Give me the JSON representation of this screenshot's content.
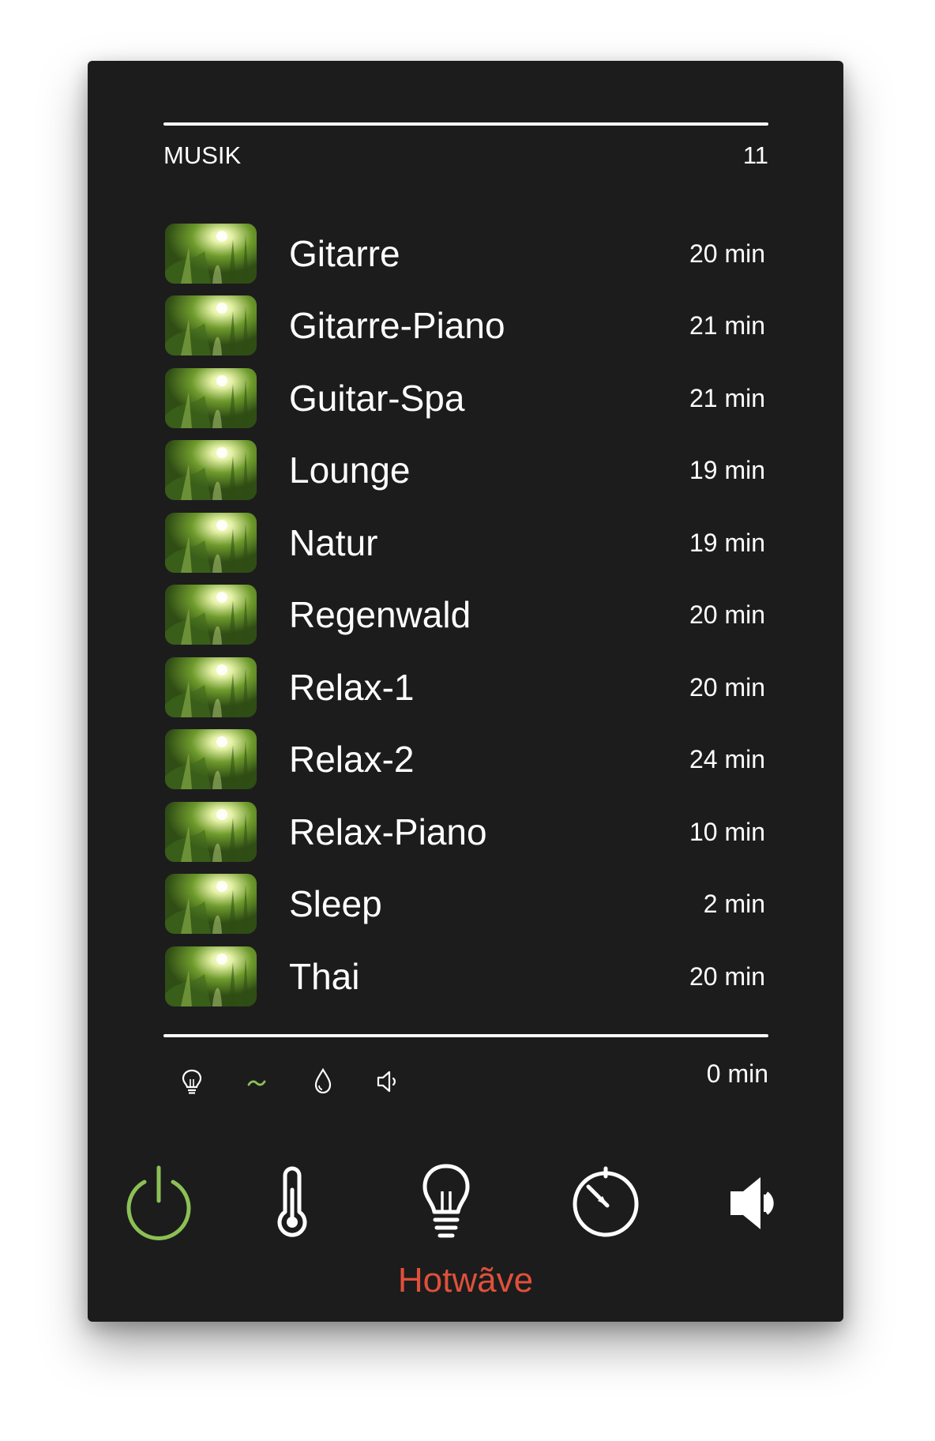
{
  "header": {
    "title": "MUSIK",
    "count": "11"
  },
  "tracks": [
    {
      "name": "Gitarre",
      "duration": "20 min"
    },
    {
      "name": "Gitarre-Piano",
      "duration": "21 min"
    },
    {
      "name": "Guitar-Spa",
      "duration": "21 min"
    },
    {
      "name": "Lounge",
      "duration": "19 min"
    },
    {
      "name": "Natur",
      "duration": "19 min"
    },
    {
      "name": "Regenwald",
      "duration": "20 min"
    },
    {
      "name": "Relax-1",
      "duration": "20 min"
    },
    {
      "name": "Relax-2",
      "duration": "24 min"
    },
    {
      "name": "Relax-Piano",
      "duration": "10 min"
    },
    {
      "name": "Sleep",
      "duration": "2 min"
    },
    {
      "name": "Thai",
      "duration": "20 min"
    }
  ],
  "status": {
    "icons": [
      "light-bulb-icon",
      "wave-icon",
      "water-drop-icon",
      "speaker-icon"
    ],
    "elapsed": "0 min"
  },
  "controls": [
    {
      "name": "power-icon",
      "active": true
    },
    {
      "name": "thermometer-icon",
      "active": false
    },
    {
      "name": "light-bulb-icon",
      "active": false
    },
    {
      "name": "timer-icon",
      "active": false
    },
    {
      "name": "speaker-icon",
      "active": false
    }
  ],
  "brand": "Hotwãve",
  "colors": {
    "panel": "#1c1c1d",
    "accent": "#8cc055",
    "brand": "#e0503a",
    "text": "#ffffff"
  }
}
